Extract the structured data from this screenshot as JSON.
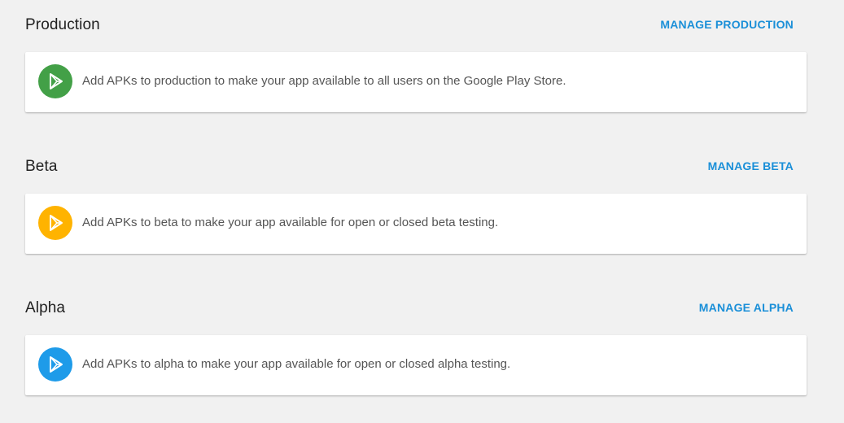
{
  "sections": [
    {
      "title": "Production",
      "manage_label": "MANAGE PRODUCTION",
      "message": "Add APKs to production to make your app available to all users on the Google Play Store.",
      "icon": "play-store-icon",
      "color": "#43a047"
    },
    {
      "title": "Beta",
      "manage_label": "MANAGE BETA",
      "message": "Add APKs to beta to make your app available for open or closed beta testing.",
      "icon": "play-store-icon",
      "color": "#ffb300"
    },
    {
      "title": "Alpha",
      "manage_label": "MANAGE ALPHA",
      "message": "Add APKs to alpha to make your app available for open or closed alpha testing.",
      "icon": "play-store-icon",
      "color": "#1e9be9"
    }
  ],
  "colors": {
    "link": "#1a8fd8",
    "background": "#f1f1f1",
    "card": "#ffffff"
  }
}
